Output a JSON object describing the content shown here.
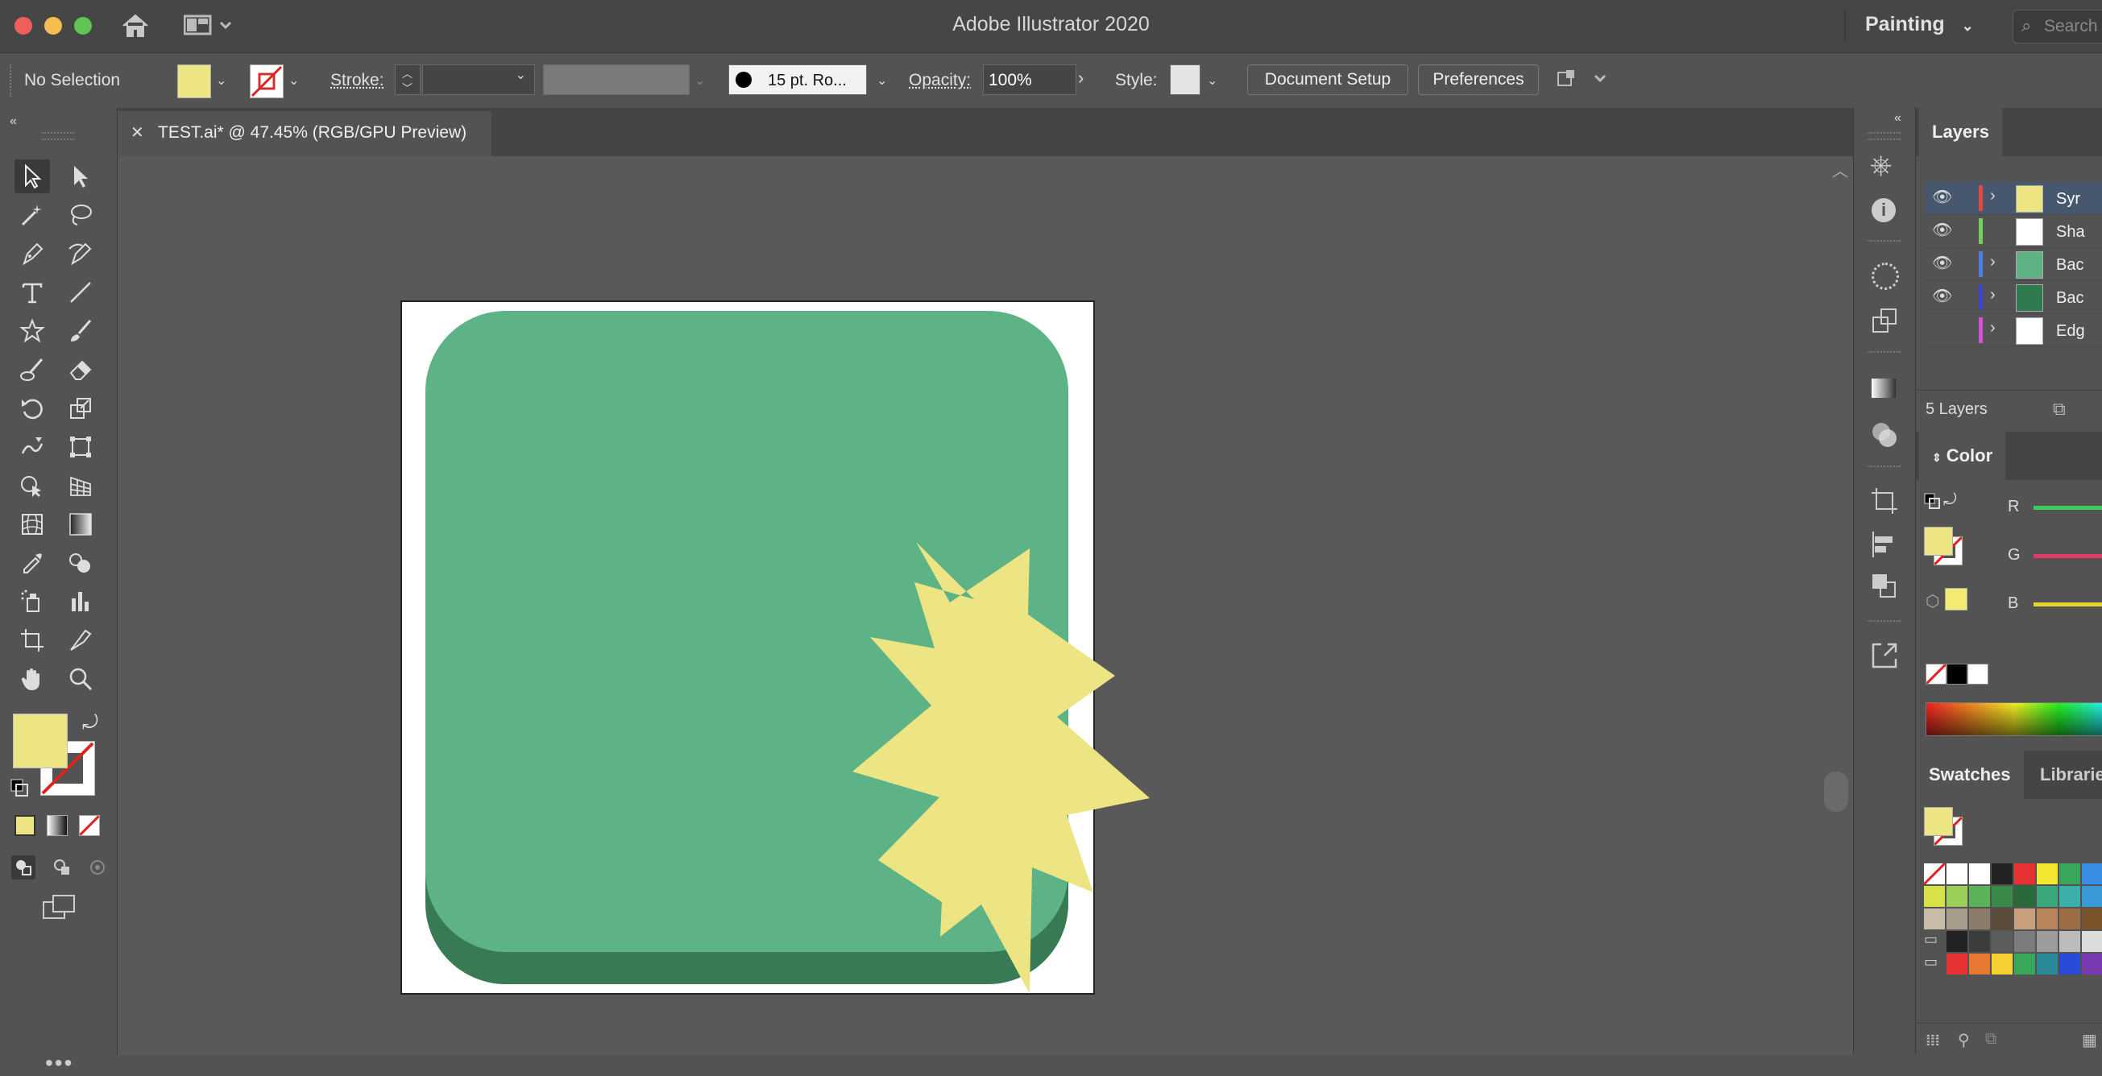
{
  "window": {
    "title": "Adobe Illustrator 2020",
    "workspace": "Painting",
    "search_placeholder": "Search"
  },
  "control_bar": {
    "selection": "No Selection",
    "stroke_label": "Stroke:",
    "brush_label": "15 pt. Ro...",
    "opacity_label": "Opacity:",
    "opacity_value": "100%",
    "style_label": "Style:",
    "document_setup": "Document Setup",
    "preferences": "Preferences"
  },
  "document_tab": {
    "title": "TEST.ai* @ 47.45% (RGB/GPU Preview)",
    "close_glyph": "✕"
  },
  "colors": {
    "fill": "#ede583",
    "app_icon_green": "#5db386",
    "app_icon_shadow": "#377a53",
    "artboard": "#ffffff"
  },
  "layers_panel": {
    "tab": "Layers",
    "layers": [
      {
        "name": "Syr",
        "color": "#e8453c",
        "thumb": "#ede583",
        "expandable": true,
        "visible": true,
        "selected": true
      },
      {
        "name": "Sha",
        "color": "#6fd05b",
        "thumb": "#ffffff",
        "expandable": false,
        "visible": true,
        "selected": false
      },
      {
        "name": "Bac",
        "color": "#4f7de8",
        "thumb": "#5db386",
        "expandable": true,
        "visible": true,
        "selected": false
      },
      {
        "name": "Bac",
        "color": "#3b44d6",
        "thumb": "#2f7a4f",
        "expandable": true,
        "visible": true,
        "selected": false
      },
      {
        "name": "Edg",
        "color": "#d64fd6",
        "thumb": "#ffffff",
        "expandable": true,
        "visible": false,
        "selected": false
      }
    ],
    "count": "5 Layers"
  },
  "color_panel": {
    "tab": "Color",
    "channels": [
      "R",
      "G",
      "B"
    ]
  },
  "swatches_panel": {
    "tabs": [
      "Swatches",
      "Libraries"
    ],
    "rows": [
      [
        "none",
        "#ffffff",
        "#ffffff",
        "#222222",
        "#e63232",
        "#f5e632",
        "#3aa85a",
        "#3a8ee6"
      ],
      [
        "#d8e04a",
        "#9ccf5a",
        "#5ab35a",
        "#3a8a4a",
        "#2a6a3a",
        "#3aa87a",
        "#3ab0a8",
        "#3a9ad8"
      ],
      [
        "#c8bca8",
        "#a89c8c",
        "#8c7c6c",
        "#5c4c3c",
        "#c8a07c",
        "#b8845c",
        "#9c6c44",
        "#7c542c"
      ],
      [
        "folder",
        "#222222",
        "#3c3c3c",
        "#5c5c5c",
        "#7c7c7c",
        "#9c9c9c",
        "#bcbcbc",
        "#dcdcdc"
      ],
      [
        "folder",
        "#e63232",
        "#e67832",
        "#f5d232",
        "#3aa85a",
        "#2a8a9a",
        "#2a4ad8",
        "#7a3ab0"
      ]
    ]
  }
}
